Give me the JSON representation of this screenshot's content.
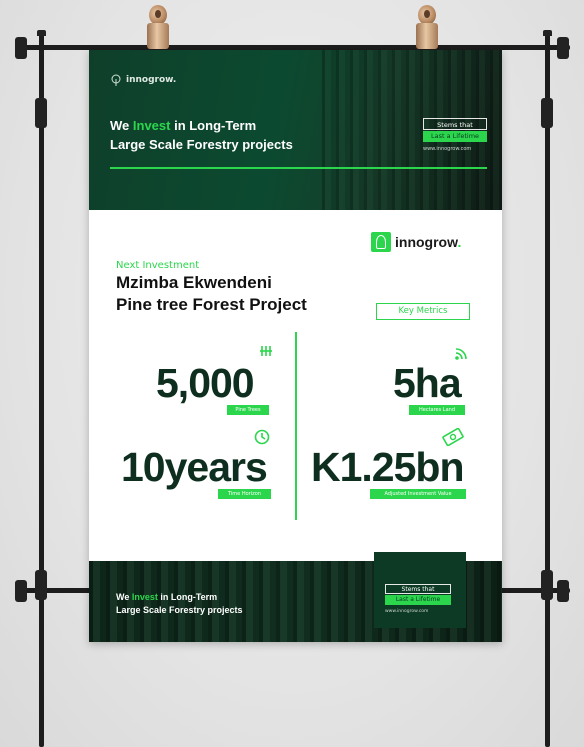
{
  "poster": {
    "top": {
      "brand": "innogrow.",
      "tagline_pre": "We ",
      "tagline_highlight": "Invest",
      "tagline_post": " in Long-Term",
      "tagline_line2": "Large Scale Forestry projects",
      "stem_line1": "Stems that",
      "stem_line2": "Last a Lifetime",
      "url": "www.innogrow.com"
    },
    "logo": {
      "name": "innogrow",
      "dot": "."
    },
    "section_label": "Next Investment",
    "project_line1": "Mzimba Ekwendeni",
    "project_line2": "Pine tree Forest Project",
    "key_metrics": "Key Metrics",
    "metrics": [
      {
        "value": "5,000",
        "label": "Pine Trees",
        "icon": "trees-icon"
      },
      {
        "value": "5ha",
        "label": "Hectares Land",
        "icon": "land-icon"
      },
      {
        "value": "10years",
        "label": "Time Horizon",
        "icon": "clock-icon"
      },
      {
        "value": "K1.25bn",
        "label": "Adjusted Investment Value",
        "icon": "money-icon"
      }
    ],
    "bottom": {
      "tagline_pre": "We ",
      "tagline_highlight": "Invest",
      "tagline_post": " in Long-Term",
      "tagline_line2": "Large Scale Forestry projects",
      "stem_line1": "Stems that",
      "stem_line2": "Last a Lifetime",
      "url": "www.innogrow.com"
    },
    "colors": {
      "accent": "#2bd64c",
      "dark_green": "#0e2f1f",
      "band": "#0b4a30"
    }
  }
}
